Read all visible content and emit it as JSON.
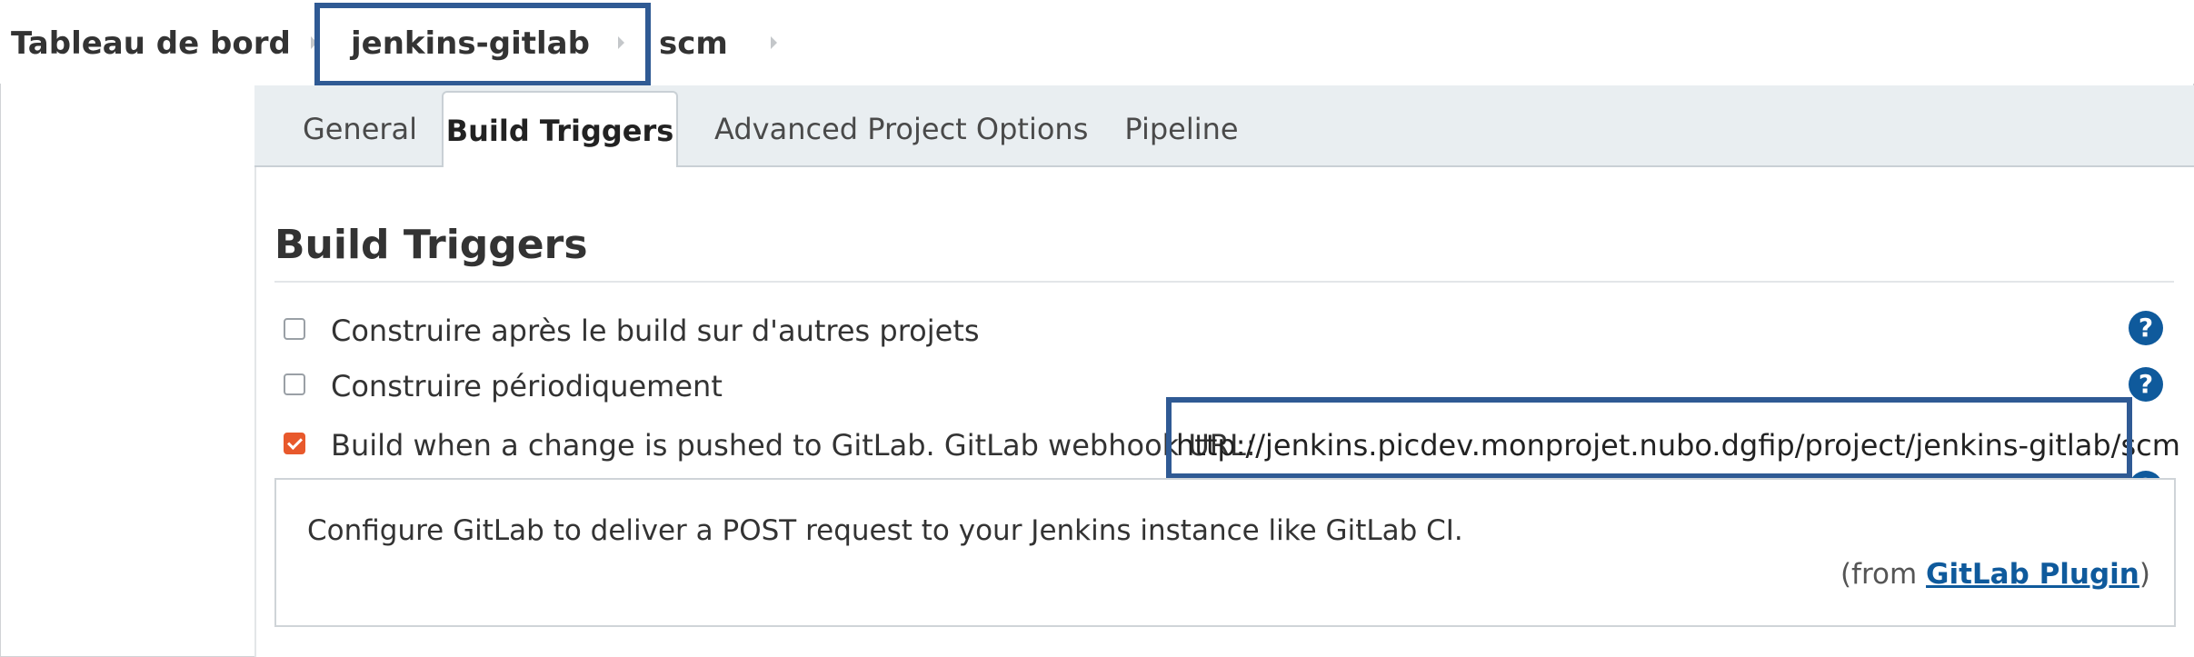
{
  "breadcrumb": {
    "items": [
      "Tableau de bord",
      "jenkins-gitlab",
      "scm"
    ]
  },
  "tabs": [
    {
      "label": "General",
      "active": false
    },
    {
      "label": "Build Triggers",
      "active": true
    },
    {
      "label": "Advanced Project Options",
      "active": false
    },
    {
      "label": "Pipeline",
      "active": false
    }
  ],
  "section": {
    "title": "Build Triggers"
  },
  "options": [
    {
      "label": "Construire après le build sur d'autres projets",
      "checked": false
    },
    {
      "label": "Construire périodiquement",
      "checked": false
    },
    {
      "label": "Build when a change is pushed to GitLab. GitLab webhook URL:",
      "checked": true
    }
  ],
  "webhook_url": "http://jenkins.picdev.monprojet.nubo.dgfip/project/jenkins-gitlab/scm",
  "help": {
    "icon_glyph": "?",
    "text": "Configure GitLab to deliver a POST request to your Jenkins instance like GitLab CI.",
    "from_prefix": "(from ",
    "from_link": "GitLab Plugin",
    "from_suffix": ")"
  },
  "colors": {
    "highlight": "#2f5a94",
    "checkbox_checked": "#e8592c",
    "help_icon": "#0f5a9c",
    "tab_strip": "#e9eef1"
  }
}
